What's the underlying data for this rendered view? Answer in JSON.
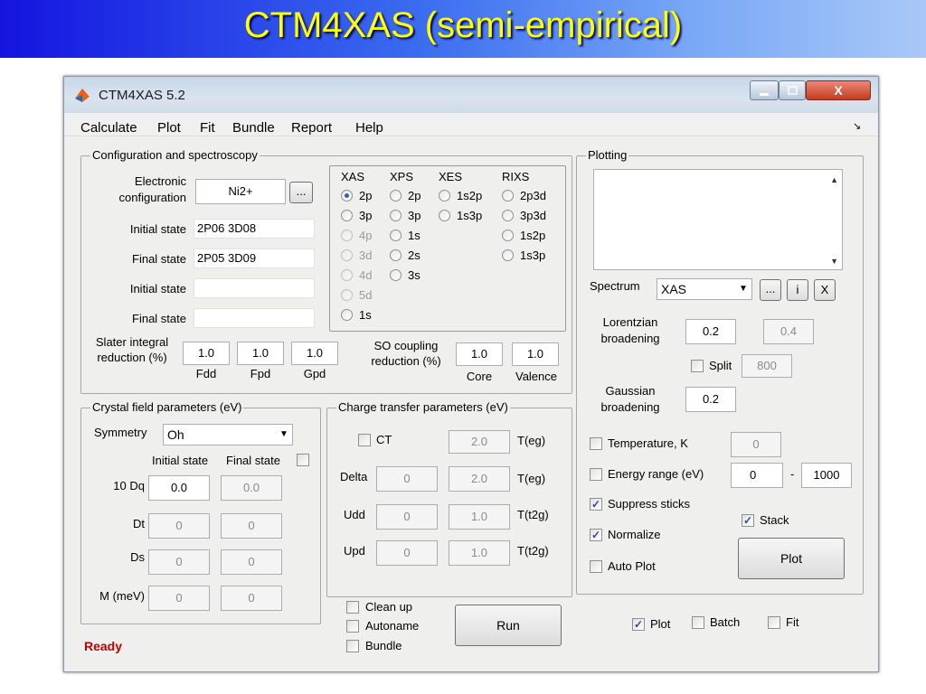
{
  "banner": {
    "title": "CTM4XAS (semi-empirical)"
  },
  "window": {
    "title": "CTM4XAS 5.2",
    "close_glyph": "X",
    "corner_glyph": "↘"
  },
  "menu": [
    "Calculate",
    "Plot",
    "Fit",
    "Bundle",
    "Report",
    "Help"
  ],
  "config": {
    "title": "Configuration and spectroscopy",
    "electronic_label_1": "Electronic",
    "electronic_label_2": "configuration",
    "electronic_value": "Ni2+",
    "browse_label": "...",
    "initial_state_label": "Initial state",
    "initial_state_value": "2P06 3D08",
    "final_state_label": "Final state",
    "final_state_value": "2P05 3D09",
    "initial_state2_label": "Initial state",
    "initial_state2_value": "",
    "final_state2_label": "Final state",
    "final_state2_value": "",
    "slater_label_1": "Slater integral",
    "slater_label_2": "reduction (%)",
    "slater_values": [
      "1.0",
      "1.0",
      "1.0"
    ],
    "slater_sub": [
      "Fdd",
      "Fpd",
      "Gpd"
    ],
    "so_label_1": "SO coupling",
    "so_label_2": "reduction (%)",
    "so_values": [
      "1.0",
      "1.0"
    ],
    "so_sub": [
      "Core",
      "Valence"
    ]
  },
  "spectro": {
    "headers": [
      "XAS",
      "XPS",
      "XES",
      "RIXS"
    ],
    "xas": [
      "2p",
      "3p",
      "4p",
      "3d",
      "4d",
      "5d",
      "1s"
    ],
    "xps": [
      "2p",
      "3p",
      "1s",
      "2s",
      "3s"
    ],
    "xes": [
      "1s2p",
      "1s3p"
    ],
    "rixs": [
      "2p3d",
      "3p3d",
      "1s2p",
      "1s3p"
    ]
  },
  "crystal": {
    "title": "Crystal field parameters (eV)",
    "symmetry_label": "Symmetry",
    "symmetry_value": "Oh",
    "initial_label": "Initial state",
    "final_label": "Final state",
    "rows": [
      {
        "label": "10 Dq",
        "initial": "0.0",
        "final": "0.0"
      },
      {
        "label": "Dt",
        "initial": "0",
        "final": "0"
      },
      {
        "label": "Ds",
        "initial": "0",
        "final": "0"
      },
      {
        "label": "M (meV)",
        "initial": "0",
        "final": "0"
      }
    ]
  },
  "charge": {
    "title": "Charge transfer parameters (eV)",
    "ct_label": "CT",
    "ct_value": "2.0",
    "ct_unit": "T(eg)",
    "rows": [
      {
        "label": "Delta",
        "v1": "0",
        "v2": "2.0",
        "unit": "T(eg)"
      },
      {
        "label": "Udd",
        "v1": "0",
        "v2": "1.0",
        "unit": "T(t2g)"
      },
      {
        "label": "Upd",
        "v1": "0",
        "v2": "1.0",
        "unit": "T(t2g)"
      }
    ]
  },
  "run": {
    "cleanup_label": "Clean up",
    "autoname_label": "Autoname",
    "bundle_label": "Bundle",
    "run_label": "Run"
  },
  "plotting": {
    "title": "Plotting",
    "spectrum_label": "Spectrum",
    "spectrum_value": "XAS",
    "btn_browse": "...",
    "btn_info": "i",
    "btn_remove": "X",
    "lorentzian_label_1": "Lorentzian",
    "lorentzian_label_2": "broadening",
    "lorentzian_value": "0.2",
    "lorentzian_value2": "0.4",
    "split_label": "Split",
    "split_value": "800",
    "gaussian_label_1": "Gaussian",
    "gaussian_label_2": "broadening",
    "gaussian_value": "0.2",
    "temperature_label": "Temperature, K",
    "temperature_value": "0",
    "energy_label": "Energy range (eV)",
    "energy_min": "0",
    "energy_sep": "-",
    "energy_max": "1000",
    "suppress_label": "Suppress sticks",
    "stack_label": "Stack",
    "normalize_label": "Normalize",
    "auto_plot_label": "Auto Plot",
    "plot_button": "Plot"
  },
  "bottom": {
    "plot_label": "Plot",
    "batch_label": "Batch",
    "fit_label": "Fit"
  },
  "status": "Ready",
  "icons": {
    "check": "✓",
    "dropdown": "▼",
    "scroll_up": "▲",
    "scroll_down": "▼"
  }
}
